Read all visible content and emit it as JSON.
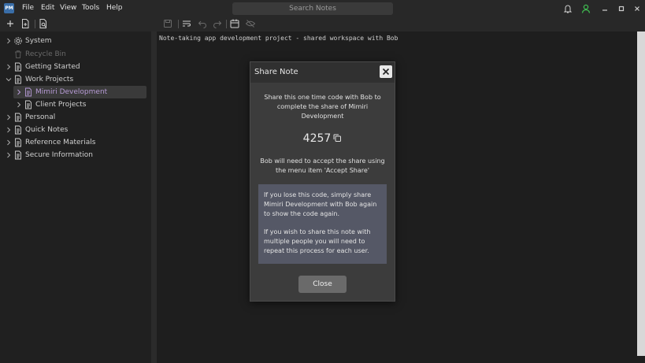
{
  "menu": {
    "logo": "PM",
    "items": [
      "File",
      "Edit",
      "View",
      "Tools",
      "Help"
    ],
    "search_placeholder": "Search Notes"
  },
  "sidebar": {
    "items": [
      {
        "label": "System",
        "icon": "gear-icon"
      },
      {
        "label": "Recycle Bin",
        "icon": "trash-icon"
      },
      {
        "label": "Getting Started",
        "icon": "document-icon"
      },
      {
        "label": "Work Projects",
        "icon": "document-icon"
      },
      {
        "label": "Mimiri Development",
        "icon": "document-icon"
      },
      {
        "label": "Client Projects",
        "icon": "document-icon"
      },
      {
        "label": "Personal",
        "icon": "document-icon"
      },
      {
        "label": "Quick Notes",
        "icon": "document-icon"
      },
      {
        "label": "Reference Materials",
        "icon": "document-icon"
      },
      {
        "label": "Secure Information",
        "icon": "document-icon"
      }
    ]
  },
  "editor": {
    "text": "Note-taking app development project - shared workspace with Bob"
  },
  "dialog": {
    "title": "Share Note",
    "intro": "Share this one time code with Bob to complete the share of Mimiri Development",
    "code": "4257",
    "accept_text": "Bob will need to accept the share using the menu item 'Accept Share'",
    "info_lose": "If you lose this code, simply share Mimiri Development with Bob again to show the code again.",
    "info_multiple": "If you wish to share this note with multiple people you will need to repeat this process for each user.",
    "close_label": "Close"
  },
  "colors": {
    "accent_selected": "#b79bd6",
    "user_online": "#3fb950",
    "info_box": "#555866"
  }
}
